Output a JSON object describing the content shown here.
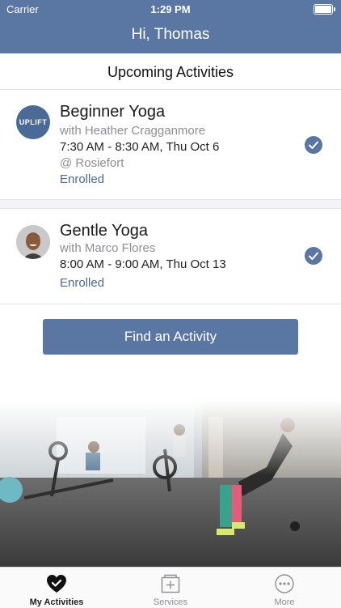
{
  "status_bar": {
    "carrier": "Carrier",
    "time": "1:29 PM"
  },
  "header": {
    "title": "Hi, Thomas",
    "color": "#5a77a3"
  },
  "section": {
    "title": "Upcoming Activities"
  },
  "activities": [
    {
      "title": "Beginner Yoga",
      "instructor": "with Heather Cragganmore",
      "time": "7:30 AM - 8:30 AM, Thu Oct 6",
      "location": "@ Rosiefort",
      "status": "Enrolled",
      "avatar_text": "UPLIFT"
    },
    {
      "title": "Gentle Yoga",
      "instructor": "with Marco Flores",
      "time": "8:00 AM - 9:00 AM, Thu Oct 13",
      "status": "Enrolled"
    }
  ],
  "find_button": {
    "label": "Find an Activity"
  },
  "tab_bar": {
    "items": [
      {
        "label": "My Activities",
        "icon": "heart-check-icon",
        "active": true
      },
      {
        "label": "Services",
        "icon": "services-icon",
        "active": false
      },
      {
        "label": "More",
        "icon": "more-icon",
        "active": false
      }
    ]
  }
}
